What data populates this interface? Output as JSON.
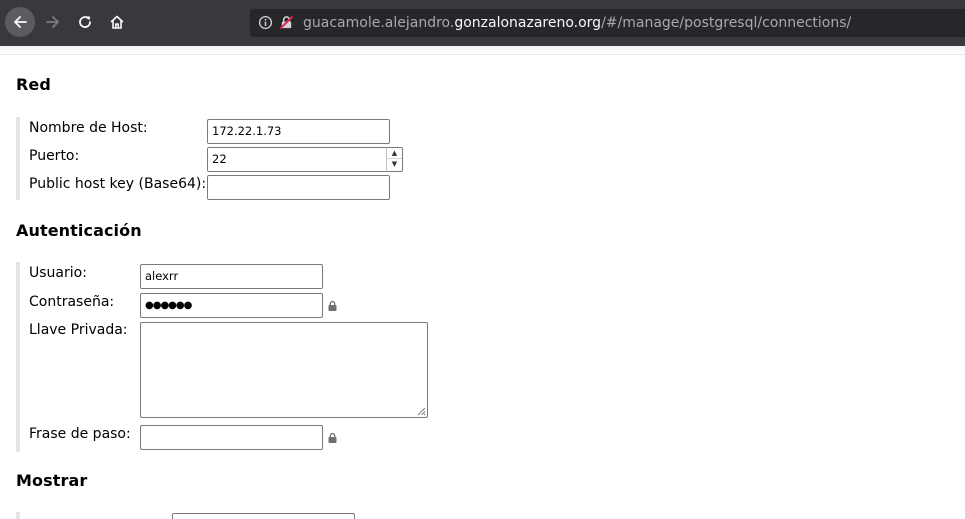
{
  "browser": {
    "url": {
      "prefix": "guacamole.alejandro.",
      "domain": "gonzalonazareno.org",
      "path": "/#/manage/postgresql/connections/"
    },
    "icons": [
      "back-arrow-icon",
      "forward-arrow-icon",
      "reload-icon",
      "home-icon",
      "info-icon",
      "insecure-lock-icon"
    ]
  },
  "sections": {
    "red": {
      "title": "Red",
      "fields": {
        "hostname": {
          "label": "Nombre de Host:",
          "value": "172.22.1.73"
        },
        "port": {
          "label": "Puerto:",
          "value": "22"
        },
        "host_key": {
          "label": "Public host key (Base64):",
          "value": ""
        }
      }
    },
    "auth": {
      "title": "Autenticación",
      "fields": {
        "username": {
          "label": "Usuario:",
          "value": "alexrr"
        },
        "password": {
          "label": "Contraseña:",
          "value": "●●●●●●"
        },
        "private_key": {
          "label": "Llave Privada:",
          "value": ""
        },
        "passphrase": {
          "label": "Frase de paso:",
          "value": ""
        }
      }
    },
    "display": {
      "title": "Mostrar"
    }
  },
  "colors": {
    "toolbar": "#38383d",
    "urlbar": "#27272b",
    "url_muted": "#a9a9ad",
    "url_domain": "#f9f9fa",
    "group_bar": "#e5e5e5",
    "input_border": "#7a7a7a"
  }
}
